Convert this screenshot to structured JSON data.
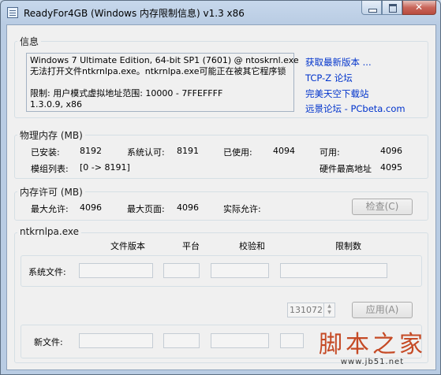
{
  "window": {
    "title": "ReadyFor4GB  (Windows 内存限制信息) v1.3 x86"
  },
  "info": {
    "group_title": "信息",
    "lines": [
      "Windows 7 Ultimate Edition, 64-bit SP1 (7601) @ ntoskrnl.exe",
      "无法打开文件ntkrnlpa.exe。ntkrnlpa.exe可能正在被其它程序锁",
      "",
      "限制:      用户模式虚拟地址范围:    10000 - 7FFEFFFF",
      "1.3.0.9, x86"
    ],
    "links": [
      "获取最新版本 ...",
      "TCP-Z 论坛",
      "完美天空下载站",
      "远景论坛 - PCbeta.com"
    ]
  },
  "physical": {
    "group_title": "物理内存 (MB)",
    "installed_label": "已安装:",
    "installed_value": "8192",
    "recognized_label": "系统认可:",
    "recognized_value": "8191",
    "used_label": "已使用:",
    "used_value": "4094",
    "available_label": "可用:",
    "available_value": "4096",
    "modules_label": "模组列表:",
    "modules_value": "[0 -> 8191]",
    "hw_max_label": "硬件最高地址",
    "hw_max_value": "4095"
  },
  "license": {
    "group_title": "内存许可 (MB)",
    "max_allowed_label": "最大允许:",
    "max_allowed_value": "4096",
    "max_page_label": "最大页面:",
    "max_page_value": "4096",
    "actual_label": "实际允许:",
    "actual_value": "",
    "check_button": "检查(C)"
  },
  "ntk": {
    "group_title": "ntkrnlpa.exe",
    "col_headers": [
      "文件版本",
      "平台",
      "校验和",
      "限制数"
    ],
    "system_file_label": "系统文件:",
    "new_file_label": "新文件:",
    "spin_value": "131072",
    "apply_button": "应用(A)"
  },
  "watermark": {
    "big": "脚本之家",
    "small": "www.jb51.net"
  },
  "colors": {
    "link": "#0033cc",
    "watermark": "#c54a25"
  }
}
